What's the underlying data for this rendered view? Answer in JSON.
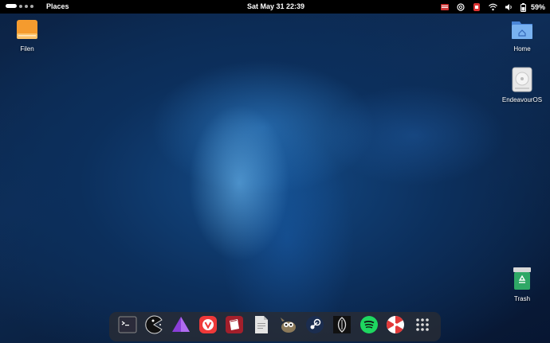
{
  "topbar": {
    "places_label": "Places",
    "clock": "Sat May 31  22:39",
    "battery_percent": "59%"
  },
  "desktop": {
    "icons": [
      {
        "label": "Filen",
        "icon": "drive-icon"
      },
      {
        "label": "Home",
        "icon": "home-folder-icon"
      },
      {
        "label": "EndeavourOS",
        "icon": "disk-icon"
      },
      {
        "label": "Trash",
        "icon": "trash-icon"
      }
    ]
  },
  "dock": {
    "apps": [
      {
        "name": "terminal",
        "icon": "terminal-icon"
      },
      {
        "name": "pacman-game",
        "icon": "pacman-icon"
      },
      {
        "name": "prism",
        "icon": "prism-icon"
      },
      {
        "name": "vivaldi",
        "icon": "vivaldi-icon"
      },
      {
        "name": "app-store",
        "icon": "box-icon"
      },
      {
        "name": "text-editor",
        "icon": "document-icon"
      },
      {
        "name": "gimp",
        "icon": "gimp-icon"
      },
      {
        "name": "steam",
        "icon": "steam-icon"
      },
      {
        "name": "oblivion",
        "icon": "oblivion-icon"
      },
      {
        "name": "spotify",
        "icon": "spotify-icon"
      },
      {
        "name": "peppermint",
        "icon": "peppermint-icon"
      },
      {
        "name": "app-grid",
        "icon": "app-grid-icon"
      }
    ]
  },
  "colors": {
    "topbar_bg": "#000000",
    "dock_bg": "#282c34",
    "wallpaper_base": "#0e2d57"
  }
}
